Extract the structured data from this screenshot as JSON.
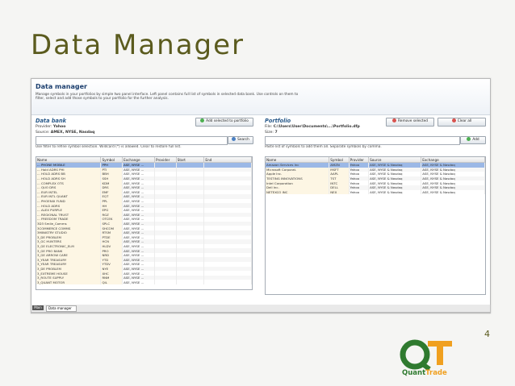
{
  "slide": {
    "title": "Data Manager",
    "page_number": "4"
  },
  "window": {
    "title": "Data manager",
    "description": "Manage symbols in your portfolios by simple two panel interface. Left panel contains full list of symbols in selected data bank. Use controls on them to filter, select and add those symbols to your portfolio for the further analysis."
  },
  "data_bank": {
    "heading": "Data bank",
    "provider_label": "Provider:",
    "provider_value": "Yahoo",
    "source_label": "Source:",
    "source_value": "AMEX, NYSE, Nasdaq",
    "search_value": "",
    "search_button": "Search",
    "hint": "Use filter to refine symbol selection. Wildcard (*) is allowed. Clear to restore full list.",
    "columns": [
      "Name",
      "Symbol",
      "Exchange",
      "Provider",
      "Start",
      "End"
    ],
    "rows": [
      [
        "... PHONE MOBILE",
        "PPH",
        "ASE, NYSE ...",
        "",
        "",
        ""
      ],
      [
        "... Hold ADRS PHI",
        "PTI",
        "ASE, NYSE ...",
        "",
        "",
        ""
      ],
      [
        "... HOLD ADRS BB",
        "BBH",
        "ASE, NYSE ...",
        "",
        "",
        ""
      ],
      [
        "... HOLD ADRS SH",
        "SSH",
        "ASE, NYSE ...",
        "",
        "",
        ""
      ],
      [
        "... COMPLEX OTS",
        "KDM",
        "ASE, NYSE ...",
        "",
        "",
        ""
      ],
      [
        "... QUO DRS",
        "DRS",
        "ASE, NYSE ...",
        "",
        "",
        ""
      ],
      [
        "... EUR INTEL",
        "EMF",
        "ASE, NYSE ...",
        "",
        "",
        ""
      ],
      [
        "... EUR INTL QUANT",
        "EQT",
        "ASE, NYSE ...",
        "",
        "",
        ""
      ],
      [
        "... PHOENIX FUND",
        "PPL",
        "ASE, NYSE ...",
        "",
        "",
        ""
      ],
      [
        "... HOLD ADRS",
        "HH",
        "ASE, NYSE ...",
        "",
        "",
        ""
      ],
      [
        "... ALEX PURPLE",
        "EPG",
        "ASE, NYSE ...",
        "",
        "",
        ""
      ],
      [
        "... REGIONAL TRUST",
        "RGZ",
        "ASE, NYSE ...",
        "",
        "",
        ""
      ],
      [
        "... FREEDOM TRADE",
        "OTCEK",
        "ASE, NYSE ...",
        "",
        "",
        ""
      ],
      [
        "3D3 Smile_Comms",
        "SPLC",
        "ASE, NYSE ...",
        "",
        "",
        ""
      ],
      [
        "3COMMERCE COMMS",
        "SHCOM",
        "ASE, NYSE ...",
        "",
        "",
        ""
      ],
      [
        "3MINISTRY STUDIO",
        "RTSM",
        "ASE, NYSE ...",
        "",
        "",
        ""
      ],
      [
        "3_DE PROBLEM",
        "PTDE",
        "ASE, NYSE ...",
        "",
        "",
        ""
      ],
      [
        "3_GC HUNTERS",
        "HCN",
        "ASE, NYSE ...",
        "",
        "",
        ""
      ],
      [
        "3_GE ELECTRONIC_ELM",
        "HLDV",
        "ASE, NYSE ...",
        "",
        "",
        ""
      ],
      [
        "3_GE PRO BANK",
        "PRO",
        "ASE, NYSE ...",
        "",
        "",
        ""
      ],
      [
        "3_GE ARROW CARE",
        "NRD",
        "ASE, NYSE ...",
        "",
        "",
        ""
      ],
      [
        "3_YEAR TREASURY",
        "YTD",
        "ASE, NYSE ...",
        "",
        "",
        ""
      ],
      [
        "3_YEAR TREASURY",
        "YTDV",
        "ASE, NYSE ...",
        "",
        "",
        ""
      ],
      [
        "3_DE PROBLEM",
        "NYE",
        "ASE, NYSE ...",
        "",
        "",
        ""
      ],
      [
        "3_EXTREME HOUSE",
        "XHC",
        "ASE, NYSE ...",
        "",
        "",
        ""
      ],
      [
        "3_ROUTE SUPPLY",
        "RNM",
        "ASE, NYSE ...",
        "",
        "",
        ""
      ],
      [
        "3_QUANT MOTOR",
        "QIL",
        "ASE, NYSE ...",
        "",
        "",
        ""
      ]
    ],
    "add_button": "Add selected to portfolio"
  },
  "portfolio": {
    "heading": "Portfolio",
    "file_label": "File:",
    "file_value": "C:\\Users\\User\\Documents\\...\\Portfolio.dfp",
    "size_label": "Size:",
    "size_value": "7",
    "add_value": "",
    "add_button": "Add",
    "hint": "Paste list of symbols to add them all. Separate symbols by comma.",
    "columns": [
      "Name",
      "Symbol",
      "Provider",
      "Source",
      "Exchange"
    ],
    "rows": [
      [
        "Amazon Services Inc",
        "AMZN",
        "Yahoo",
        "ASE, NYSE & Nasdaq",
        "ASE, NYSE & Nasdaq"
      ],
      [
        "Microsoft Corporat.",
        "MSFT",
        "Yahoo",
        "ASE, NYSE & Nasdaq",
        "ASE, NYSE & Nasdaq"
      ],
      [
        "Apple Inc.",
        "AAPL",
        "Yahoo",
        "ASE, NYSE & Nasdaq",
        "ASE, NYSE & Nasdaq"
      ],
      [
        "TESTING INNOVATIONS",
        "TST",
        "Yahoo",
        "ASE, NYSE & Nasdaq",
        "ASE, NYSE & Nasdaq"
      ],
      [
        "Intel Corporation",
        "INTC",
        "Yahoo",
        "ASE, NYSE & Nasdaq",
        "ASE, NYSE & Nasdaq"
      ],
      [
        "Dell Inc.",
        "DELL",
        "Yahoo",
        "ASE, NYSE & Nasdaq",
        "ASE, NYSE & Nasdaq"
      ],
      [
        "NETEXCO INC",
        "NEX",
        "Yahoo",
        "ASE, NYSE & Nasdaq",
        "ASE, NYSE & Nasdaq"
      ]
    ],
    "remove_button": "Remove selected",
    "clear_button": "Clear all"
  },
  "statusbar": {
    "tab_label": "Main",
    "select_value": "Data manager"
  },
  "logo": {
    "text_a": "Quant",
    "text_b": "Trade"
  },
  "colors": {
    "title": "#5b5b1e",
    "heading": "#2a5a8a",
    "selection": "#9bb8e6",
    "logo_green": "#2f7a2f",
    "logo_orange": "#f0a020"
  }
}
